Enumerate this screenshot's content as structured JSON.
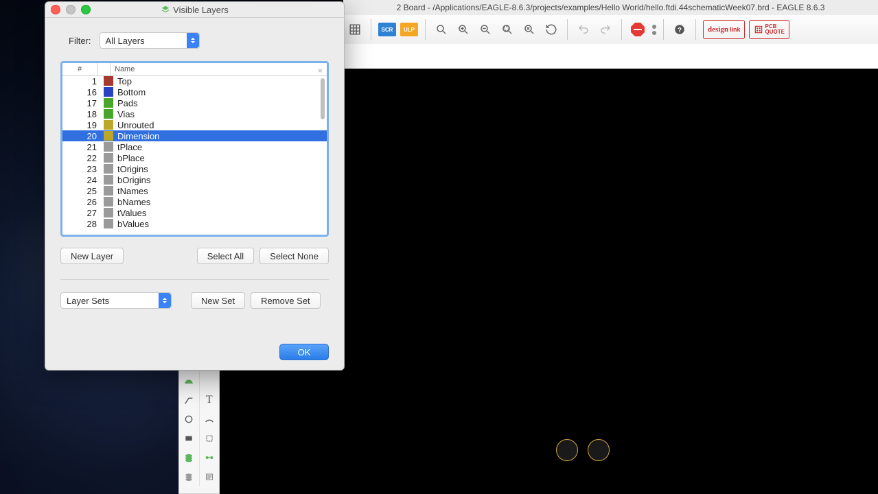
{
  "main_window": {
    "title": "2 Board - /Applications/EAGLE-8.6.3/projects/examples/Hello World/hello.ftdi.44schematicWeek07.brd - EAGLE 8.6.3"
  },
  "toolbar": {
    "scr_label": "SCR",
    "ulp_label": "ULP",
    "design_link": "design link",
    "pcb_quote": "PCB QUOTE"
  },
  "dialog": {
    "title": "Visible Layers",
    "filter_label": "Filter:",
    "filter_value": "All Layers",
    "columns": {
      "num": "#",
      "name": "Name"
    },
    "layers": [
      {
        "num": 1,
        "name": "Top",
        "color": "#a63a32",
        "selected": false
      },
      {
        "num": 16,
        "name": "Bottom",
        "color": "#2943c0",
        "selected": false
      },
      {
        "num": 17,
        "name": "Pads",
        "color": "#49a62c",
        "selected": false
      },
      {
        "num": 18,
        "name": "Vias",
        "color": "#49a62c",
        "selected": false
      },
      {
        "num": 19,
        "name": "Unrouted",
        "color": "#bba72a",
        "selected": false
      },
      {
        "num": 20,
        "name": "Dimension",
        "color": "#bba72a",
        "selected": true
      },
      {
        "num": 21,
        "name": "tPlace",
        "color": "#9a9a9a",
        "selected": false
      },
      {
        "num": 22,
        "name": "bPlace",
        "color": "#9a9a9a",
        "selected": false
      },
      {
        "num": 23,
        "name": "tOrigins",
        "color": "#9a9a9a",
        "selected": false
      },
      {
        "num": 24,
        "name": "bOrigins",
        "color": "#9a9a9a",
        "selected": false
      },
      {
        "num": 25,
        "name": "tNames",
        "color": "#9a9a9a",
        "selected": false
      },
      {
        "num": 26,
        "name": "bNames",
        "color": "#9a9a9a",
        "selected": false
      },
      {
        "num": 27,
        "name": "tValues",
        "color": "#9a9a9a",
        "selected": false
      },
      {
        "num": 28,
        "name": "bValues",
        "color": "#9a9a9a",
        "selected": false
      }
    ],
    "buttons": {
      "new_layer": "New Layer",
      "select_all": "Select All",
      "select_none": "Select None",
      "layer_sets": "Layer Sets",
      "new_set": "New Set",
      "remove_set": "Remove Set",
      "ok": "OK"
    }
  }
}
